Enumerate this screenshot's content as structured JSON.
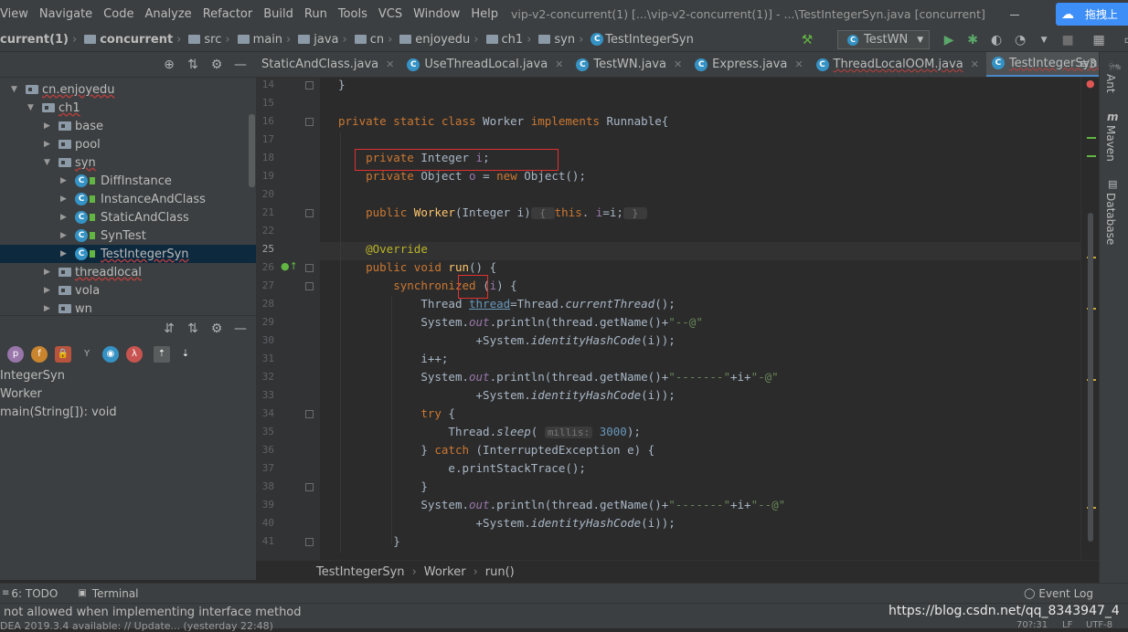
{
  "menu": [
    "View",
    "Navigate",
    "Code",
    "Analyze",
    "Refactor",
    "Build",
    "Run",
    "Tools",
    "VCS",
    "Window",
    "Help"
  ],
  "window_title": "vip-v2-concurrent(1) [...\\vip-v2-concurrent(1)] - ...\\TestIntegerSyn.java [concurrent]",
  "cloud_button": "拖拽上",
  "nav_crumbs": [
    "current(1)",
    "concurrent",
    "src",
    "main",
    "java",
    "cn",
    "enjoyedu",
    "ch1",
    "syn",
    "TestIntegerSyn"
  ],
  "run_config": "TestWN",
  "tree": {
    "root": "cn.enjoyedu",
    "ch1": "ch1",
    "packages": [
      "base",
      "pool",
      "syn"
    ],
    "syn_classes": [
      "DiffInstance",
      "InstanceAndClass",
      "StaticAndClass",
      "SynTest",
      "TestIntegerSyn"
    ],
    "more_packages": [
      "threadlocal",
      "vola",
      "wn"
    ]
  },
  "structure": {
    "filters": [
      "p",
      "f",
      "🔒",
      "Y",
      "◉",
      "λ"
    ],
    "items": [
      "IntegerSyn",
      "Worker",
      "main(String[]): void"
    ]
  },
  "tabs": [
    {
      "label": "StaticAndClass.java",
      "active": false,
      "warn": false
    },
    {
      "label": "UseThreadLocal.java",
      "active": false,
      "warn": false
    },
    {
      "label": "TestWN.java",
      "active": false,
      "warn": false
    },
    {
      "label": "Express.java",
      "active": false,
      "warn": false
    },
    {
      "label": "ThreadLocalOOM.java",
      "active": false,
      "warn": true
    },
    {
      "label": "TestIntegerSyn.java",
      "active": true,
      "warn": true
    }
  ],
  "tab_overflow": "≡3",
  "line_numbers": [
    "14",
    "15",
    "16",
    "17",
    "18",
    "19",
    "20",
    "21",
    "22",
    "25",
    "26",
    "27",
    "28",
    "29",
    "30",
    "31",
    "32",
    "33",
    "34",
    "35",
    "36",
    "37",
    "38",
    "39",
    "40",
    "41"
  ],
  "code_lines": [
    [
      [
        "",
        "}"
      ]
    ],
    [],
    [
      [
        "kw",
        "private static class "
      ],
      [
        "",
        "Worker "
      ],
      [
        "kw",
        "implements "
      ],
      [
        "",
        "Runnable{"
      ]
    ],
    [],
    [
      [
        "",
        "    "
      ],
      [
        "kw",
        "private "
      ],
      [
        "",
        "Integer "
      ],
      [
        "fld",
        "i"
      ],
      [
        "",
        ";"
      ]
    ],
    [
      [
        "",
        "    "
      ],
      [
        "kw",
        "private "
      ],
      [
        "",
        "Object "
      ],
      [
        "fld",
        "o "
      ],
      [
        "",
        "= "
      ],
      [
        "kw",
        "new "
      ],
      [
        "",
        "Object();"
      ]
    ],
    [],
    [
      [
        "",
        "    "
      ],
      [
        "kw",
        "public "
      ],
      [
        "mth",
        "Worker"
      ],
      [
        "",
        "(Integer i)"
      ],
      [
        "hint",
        " { "
      ],
      [
        "kw",
        "this"
      ],
      [
        "",
        ". "
      ],
      [
        "fld",
        "i"
      ],
      [
        "",
        "=i;"
      ],
      [
        "hint",
        " } "
      ]
    ],
    [],
    [
      [
        "",
        "    "
      ],
      [
        "ann",
        "@Override"
      ]
    ],
    [
      [
        "",
        "    "
      ],
      [
        "kw",
        "public void "
      ],
      [
        "mth",
        "run"
      ],
      [
        "",
        "() {"
      ]
    ],
    [
      [
        "",
        "        "
      ],
      [
        "kw",
        "synchronized "
      ],
      [
        "",
        "("
      ],
      [
        "fld",
        "i"
      ],
      [
        "",
        ") {"
      ]
    ],
    [
      [
        "",
        "            "
      ],
      [
        "",
        "Thread "
      ],
      [
        "",
        "thread"
      ],
      [
        "",
        "=Thread."
      ],
      [
        "it",
        "currentThread"
      ],
      [
        "",
        "();"
      ]
    ],
    [
      [
        "",
        "            "
      ],
      [
        "",
        "System."
      ],
      [
        "fld it",
        "out"
      ],
      [
        "",
        ".println(thread.getName()+"
      ],
      [
        "str",
        "\"--@\""
      ]
    ],
    [
      [
        "",
        "                    "
      ],
      [
        "",
        "+System."
      ],
      [
        "it",
        "identityHashCode"
      ],
      [
        "",
        "(i));"
      ]
    ],
    [
      [
        "",
        "            "
      ],
      [
        "",
        "i++;"
      ]
    ],
    [
      [
        "",
        "            "
      ],
      [
        "",
        "System."
      ],
      [
        "fld it",
        "out"
      ],
      [
        "",
        ".println(thread.getName()+"
      ],
      [
        "str",
        "\"-------\""
      ],
      [
        "",
        "+i+"
      ],
      [
        "str",
        "\"-@\""
      ]
    ],
    [
      [
        "",
        "                    "
      ],
      [
        "",
        "+System."
      ],
      [
        "it",
        "identityHashCode"
      ],
      [
        "",
        "(i));"
      ]
    ],
    [
      [
        "",
        "            "
      ],
      [
        "kw",
        "try "
      ],
      [
        "",
        "{"
      ]
    ],
    [
      [
        "",
        "                "
      ],
      [
        "",
        "Thread."
      ],
      [
        "it",
        "sleep"
      ],
      [
        "",
        "( "
      ],
      [
        "hint",
        "millis:"
      ],
      [
        "num",
        " 3000"
      ],
      [
        "",
        ");"
      ]
    ],
    [
      [
        "",
        "            "
      ],
      [
        "",
        "} "
      ],
      [
        "kw",
        "catch "
      ],
      [
        "",
        "(InterruptedException e) {"
      ]
    ],
    [
      [
        "",
        "                "
      ],
      [
        "",
        "e.printStackTrace();"
      ]
    ],
    [
      [
        "",
        "            "
      ],
      [
        "",
        "}"
      ]
    ],
    [
      [
        "",
        "            "
      ],
      [
        "",
        "System."
      ],
      [
        "fld it",
        "out"
      ],
      [
        "",
        ".println(thread.getName()+"
      ],
      [
        "str",
        "\"-------\""
      ],
      [
        "",
        "+i+"
      ],
      [
        "str",
        "\"--@\""
      ]
    ],
    [
      [
        "",
        "                    "
      ],
      [
        "",
        "+System."
      ],
      [
        "it",
        "identityHashCode"
      ],
      [
        "",
        "(i));"
      ]
    ],
    [
      [
        "",
        "        "
      ],
      [
        "",
        "}"
      ]
    ]
  ],
  "editor_breadcrumb": [
    "TestIntegerSyn",
    "Worker",
    "run()"
  ],
  "right_tabs": [
    "Ant",
    "Maven",
    "Database"
  ],
  "bottom_tools": {
    "todo": "6: TODO",
    "terminal": "Terminal",
    "event_log": "Event Log"
  },
  "status": {
    "message": "not allowed when implementing interface method",
    "update": "DEA 2019.3.4 available: // Update... (yesterday 22:48)",
    "watermark": "https://blog.csdn.net/qq_8343947_4",
    "position": "70?:31",
    "line_sep": "LF",
    "encoding": "UTF-8"
  },
  "colors": {
    "keyword": "#cc7832",
    "field": "#9876aa",
    "string": "#6a8759",
    "number": "#6897bb",
    "method": "#ffc66d",
    "annotation": "#bbb529",
    "highlight_box": "#e03030"
  }
}
